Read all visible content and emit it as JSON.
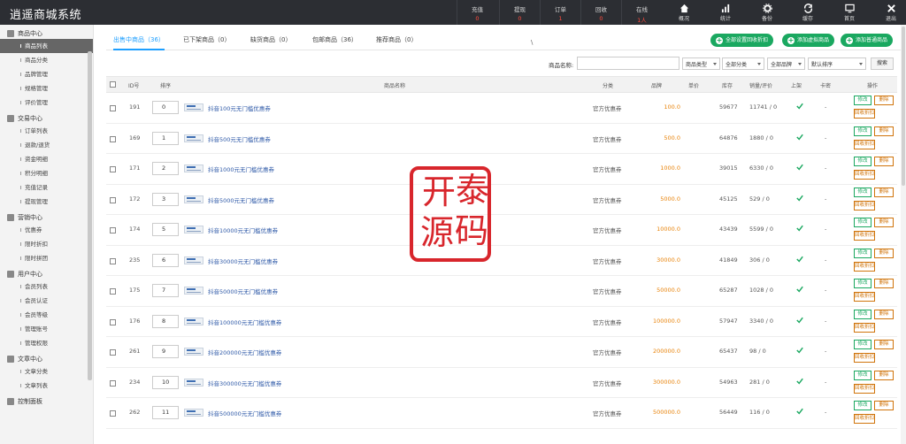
{
  "app": {
    "title": "逍遥商城系统"
  },
  "top_stats": [
    {
      "label": "充值",
      "value": "0"
    },
    {
      "label": "提现",
      "value": "0"
    },
    {
      "label": "订单",
      "value": "1"
    },
    {
      "label": "回收",
      "value": "0"
    },
    {
      "label": "在线",
      "value": "1人"
    }
  ],
  "top_nav": [
    {
      "label": "概况",
      "icon": "home-icon"
    },
    {
      "label": "统计",
      "icon": "bar-chart-icon"
    },
    {
      "label": "备份",
      "icon": "gear-icon"
    },
    {
      "label": "缓存",
      "icon": "refresh-icon"
    },
    {
      "label": "首页",
      "icon": "monitor-icon"
    },
    {
      "label": "退出",
      "icon": "close-icon"
    }
  ],
  "sidebar": {
    "groups": [
      {
        "title": "商品中心",
        "items": [
          "商品列表",
          "商品分类",
          "品牌管理",
          "规格管理",
          "评价管理"
        ]
      },
      {
        "title": "交易中心",
        "items": [
          "订单列表",
          "退款/退货",
          "资金明细",
          "积分明细",
          "充值记录",
          "提现管理"
        ]
      },
      {
        "title": "营销中心",
        "items": [
          "优惠券",
          "限时折扣",
          "限时拼团"
        ]
      },
      {
        "title": "用户中心",
        "items": [
          "会员列表",
          "会员认证",
          "会员等级",
          "管理账号",
          "管理权限"
        ]
      },
      {
        "title": "文章中心",
        "items": [
          "文章分类",
          "文章列表"
        ]
      },
      {
        "title": "控制面板",
        "items": []
      }
    ],
    "active": "商品列表"
  },
  "tabs": [
    {
      "label": "出售中商品（36）",
      "active": true
    },
    {
      "label": "已下架商品（0）",
      "active": false
    },
    {
      "label": "缺货商品（0）",
      "active": false
    },
    {
      "label": "包邮商品（36）",
      "active": false
    },
    {
      "label": "推荐商品（0）",
      "active": false
    }
  ],
  "tab_cursor": "\\",
  "actions": {
    "set_recycle": "全部设置回收折扣",
    "add_virtual": "添加虚拟商品",
    "add_normal": "添加普通商品"
  },
  "filter": {
    "name_label": "商品名称:",
    "name_placeholder": "",
    "type_select": "商品类型",
    "category_select": "全部分类",
    "brand_select": "全部品牌",
    "sort_select": "默认排序",
    "search_button": "搜索"
  },
  "table": {
    "headers": {
      "id": "ID号",
      "sort": "排序",
      "name": "商品名称",
      "category": "分类",
      "brand": "品牌",
      "price": "单价",
      "stock": "库存",
      "sales": "销量/评价",
      "on_shelf": "上架",
      "card": "卡密",
      "ops": "操作"
    },
    "rows": [
      {
        "id": "191",
        "sort": "0",
        "name": "抖音100元无门槛优惠券",
        "category": "官方优惠券",
        "price": "100.0",
        "stock": "59677",
        "sales": "11741 / 0",
        "card": "-"
      },
      {
        "id": "169",
        "sort": "1",
        "name": "抖音500元无门槛优惠券",
        "category": "官方优惠券",
        "price": "500.0",
        "stock": "64876",
        "sales": "1880 / 0",
        "card": "-"
      },
      {
        "id": "171",
        "sort": "2",
        "name": "抖音1000元无门槛优惠券",
        "category": "官方优惠券",
        "price": "1000.0",
        "stock": "39015",
        "sales": "6330 / 0",
        "card": "-"
      },
      {
        "id": "172",
        "sort": "3",
        "name": "抖音5000元无门槛优惠券",
        "category": "官方优惠券",
        "price": "5000.0",
        "stock": "45125",
        "sales": "529 / 0",
        "card": "-"
      },
      {
        "id": "174",
        "sort": "5",
        "name": "抖音10000元无门槛优惠券",
        "category": "官方优惠券",
        "price": "10000.0",
        "stock": "43439",
        "sales": "5599 / 0",
        "card": "-"
      },
      {
        "id": "235",
        "sort": "6",
        "name": "抖音30000元无门槛优惠券",
        "category": "官方优惠券",
        "price": "30000.0",
        "stock": "41849",
        "sales": "306 / 0",
        "card": "-"
      },
      {
        "id": "175",
        "sort": "7",
        "name": "抖音50000元无门槛优惠券",
        "category": "官方优惠券",
        "price": "50000.0",
        "stock": "65287",
        "sales": "1028 / 0",
        "card": "-"
      },
      {
        "id": "176",
        "sort": "8",
        "name": "抖音100000元无门槛优惠券",
        "category": "官方优惠券",
        "price": "100000.0",
        "stock": "57947",
        "sales": "3340 / 0",
        "card": "-"
      },
      {
        "id": "261",
        "sort": "9",
        "name": "抖音200000元无门槛优惠券",
        "category": "官方优惠券",
        "price": "200000.0",
        "stock": "65437",
        "sales": "98 / 0",
        "card": "-"
      },
      {
        "id": "234",
        "sort": "10",
        "name": "抖音300000元无门槛优惠券",
        "category": "官方优惠券",
        "price": "300000.0",
        "stock": "54963",
        "sales": "281 / 0",
        "card": "-"
      },
      {
        "id": "262",
        "sort": "11",
        "name": "抖音500000元无门槛优惠券",
        "category": "官方优惠券",
        "price": "500000.0",
        "stock": "56449",
        "sales": "116 / 0",
        "card": "-"
      }
    ],
    "row_buttons": {
      "edit": "修改",
      "delete": "删除",
      "recycle": "回收折扣"
    }
  },
  "watermark": {
    "text": "开泰源码"
  },
  "colors": {
    "accent": "#1e9fff",
    "green": "#1aa860",
    "orange": "#e8830a",
    "red_stat": "#ff4a3d",
    "topbar": "#2c2e33"
  }
}
